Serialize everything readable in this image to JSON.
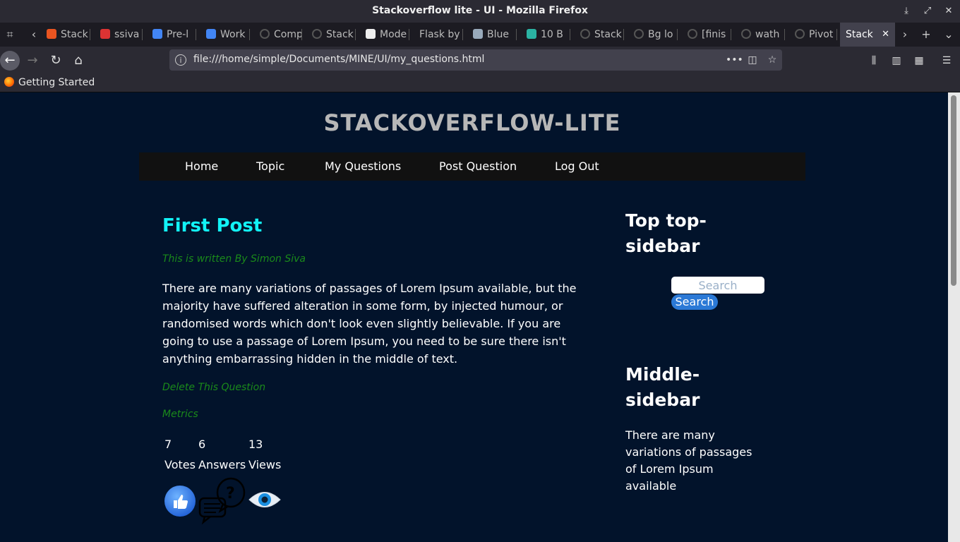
{
  "window": {
    "title": "Stackoverflow lite - UI - Mozilla Firefox"
  },
  "tabs": [
    {
      "label": "Stack",
      "icon": "ubuntu-icon"
    },
    {
      "label": "ssiva",
      "icon": "andela-icon"
    },
    {
      "label": "Pre-l",
      "icon": "google-docs-icon"
    },
    {
      "label": "Work",
      "icon": "google-docs-icon"
    },
    {
      "label": "Comp",
      "icon": "github-icon"
    },
    {
      "label": "Stack",
      "icon": "github-icon"
    },
    {
      "label": "Mode",
      "icon": "wiki-icon"
    },
    {
      "label": "Flask by",
      "icon": ""
    },
    {
      "label": "Blue",
      "icon": "book-icon"
    },
    {
      "label": "10 B",
      "icon": "medium-icon"
    },
    {
      "label": "Stack",
      "icon": "github-icon"
    },
    {
      "label": "Bg lo",
      "icon": "github-icon"
    },
    {
      "label": "[finis",
      "icon": "github-icon"
    },
    {
      "label": "wath",
      "icon": "github-icon"
    },
    {
      "label": "Pivot",
      "icon": "github-icon"
    },
    {
      "label": "Stack",
      "icon": "",
      "active": true
    }
  ],
  "toolbar": {
    "url": "file:///home/simple/Documents/MINE/UI/my_questions.html"
  },
  "bookmarks": [
    {
      "label": "Getting Started"
    }
  ],
  "site": {
    "title": "STACKOVERFLOW-LITE",
    "nav": [
      "Home",
      "Topic",
      "My Questions",
      "Post Question",
      "Log Out"
    ]
  },
  "post": {
    "title": "First Post",
    "byline": "This is written By Simon Siva",
    "body": "There are many variations of passages of Lorem Ipsum available, but the majority have suffered alteration in some form, by injected humour, or randomised words which don't look even slightly believable. If you are going to use a passage of Lorem Ipsum, you need to be sure there isn't anything embarrassing hidden in the middle of text.",
    "delete_link": "Delete This Question",
    "metrics_label": "Metrics",
    "votes_count": "7",
    "answers_count": "6",
    "views_count": "13",
    "votes_label": "Votes",
    "answers_label": "Answers",
    "views_label": "Views"
  },
  "sidebar": {
    "top_heading": "Top top-sidebar",
    "search_placeholder": "Search",
    "search_button": "Search",
    "middle_heading": "Middle-sidebar",
    "middle_text": "There are many variations of passages of Lorem Ipsum available"
  },
  "colors": {
    "page_bg": "#02132b",
    "post_title": "#12f3f7",
    "meta_green": "#1a8a1a",
    "nav_bg": "#111111",
    "search_button": "#2b79d6"
  }
}
